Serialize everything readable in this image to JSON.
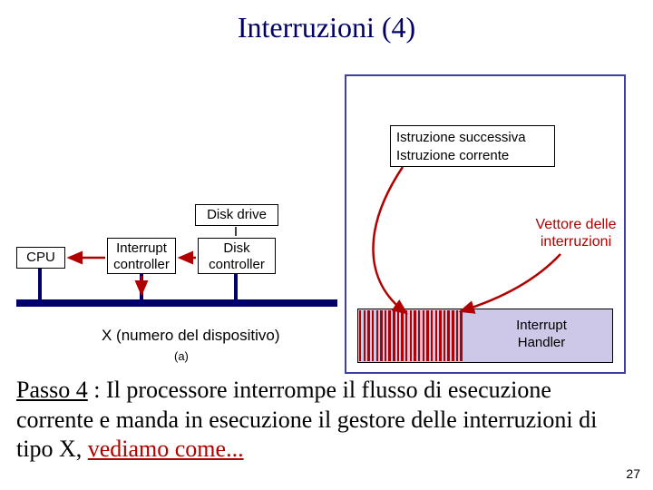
{
  "title": "Interruzioni (4)",
  "instr": {
    "line1": "Istruzione successiva",
    "line2": "Istruzione corrente"
  },
  "boxes": {
    "disk_drive": "Disk drive",
    "cpu": "CPU",
    "ic_l1": "Interrupt",
    "ic_l2": "controller",
    "dc_l1": "Disk",
    "dc_l2": "controller"
  },
  "vettore": {
    "l1": "Vettore delle",
    "l2": "interruzioni"
  },
  "handler": {
    "l1": "Interrupt",
    "l2": "Handler"
  },
  "device_label": "X (numero del dispositivo)",
  "a_label": "(a)",
  "body": {
    "lead": "Passo 4",
    "rest1": " : Il processore interrompe il flusso di esecuzione corrente e manda in esecuzione il gestore delle interruzioni di tipo X,  ",
    "highlight": "vediamo come..."
  },
  "slide_num": "27"
}
